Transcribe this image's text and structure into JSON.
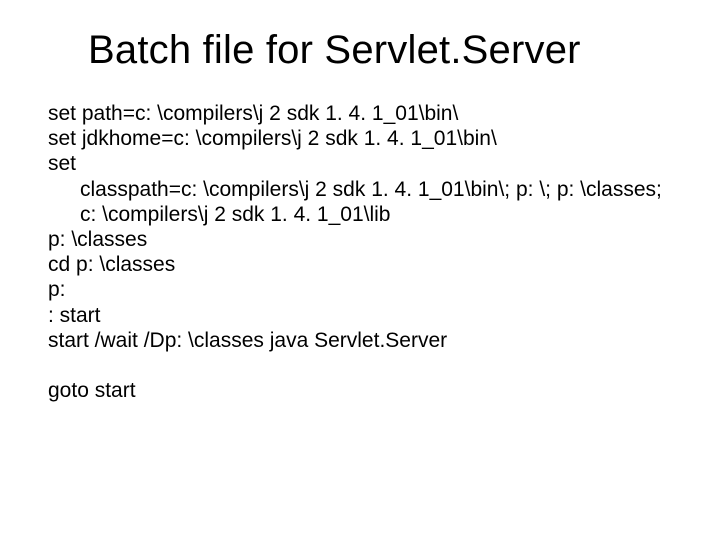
{
  "title": "Batch file for Servlet.Server",
  "lines": {
    "l1": "set path=c: \\compilers\\j 2 sdk 1. 4. 1_01\\bin\\",
    "l2": "set jdkhome=c: \\compilers\\j 2 sdk 1. 4. 1_01\\bin\\",
    "l3": "set",
    "l4": "classpath=c: \\compilers\\j 2 sdk 1. 4. 1_01\\bin\\; p: \\; p: \\classes;",
    "l5": "c: \\compilers\\j 2 sdk 1. 4. 1_01\\lib",
    "l6": "p: \\classes",
    "l7": "cd p: \\classes",
    "l8": "p:",
    "l9": ": start",
    "l10": "start /wait /Dp: \\classes java Servlet.Server",
    "l11": "goto start"
  }
}
